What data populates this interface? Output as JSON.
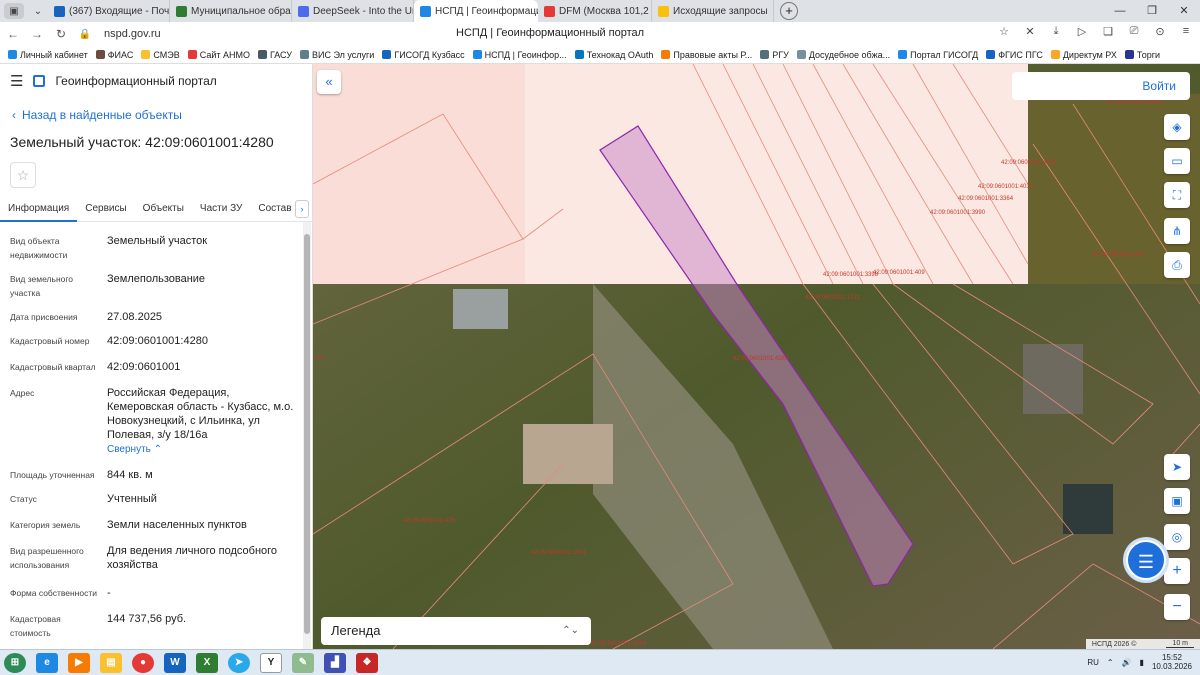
{
  "browser": {
    "tabs": [
      {
        "label": "(367) Входящие - Почта М",
        "fav_color": "#1565c0"
      },
      {
        "label": "Муниципальное образова",
        "fav_color": "#2e7d32"
      },
      {
        "label": "DeepSeek - Into the Unkno",
        "fav_color": "#4f6bed"
      },
      {
        "label": "НСПД | Геоинформацио",
        "fav_color": "#1e88e5",
        "active": true
      },
      {
        "label": "DFM (Москва 101,2",
        "fav_color": "#e53935"
      },
      {
        "label": "Исходящие запросы",
        "fav_color": "#f9c10b"
      }
    ],
    "new_tab": "+",
    "url": "nspd.gov.ru",
    "page_title": "НСПД | Геоинформационный портал",
    "bookmarks": [
      {
        "label": "Личный кабинет",
        "color": "#1e88e5"
      },
      {
        "label": "ФИАС",
        "color": "#6d4c41"
      },
      {
        "label": "СМЭВ",
        "color": "#fbc02d"
      },
      {
        "label": "Сайт АНМО",
        "color": "#e53935"
      },
      {
        "label": "ГАСУ",
        "color": "#455a64"
      },
      {
        "label": "ВИС Эл услуги",
        "color": "#607d8b"
      },
      {
        "label": "ГИСОГД Кузбасс",
        "color": "#1565c0"
      },
      {
        "label": "НСПД | Геоинфор...",
        "color": "#1e88e5"
      },
      {
        "label": "Технокад OAuth",
        "color": "#0277bd"
      },
      {
        "label": "Правовые акты Р...",
        "color": "#f57c00"
      },
      {
        "label": "РГУ",
        "color": "#546e7a"
      },
      {
        "label": "Досудебное обжа...",
        "color": "#78909c"
      },
      {
        "label": "Портал ГИСОГД",
        "color": "#1e88e5"
      },
      {
        "label": "ФГИС ПГС",
        "color": "#1565c0"
      },
      {
        "label": "Директум РХ",
        "color": "#f9a825"
      },
      {
        "label": "Торги",
        "color": "#283593"
      }
    ]
  },
  "panel": {
    "portal_name": "Геоинформационный портал",
    "back_label": "Назад в найденные объекты",
    "title": "Земельный участок: 42:09:0601001:4280",
    "tabs": [
      "Информация",
      "Сервисы",
      "Объекты",
      "Части ЗУ",
      "Состав"
    ],
    "rows": [
      {
        "label": "Вид объекта недвижимости",
        "value": "Земельный участок"
      },
      {
        "label": "Вид земельного участка",
        "value": "Землепользование"
      },
      {
        "label": "Дата присвоения",
        "value": "27.08.2025"
      },
      {
        "label": "Кадастровый номер",
        "value": "42:09:0601001:4280"
      },
      {
        "label": "Кадастровый квартал",
        "value": "42:09:0601001"
      },
      {
        "label": "Адрес",
        "value": "Российская Федерация, Кемеровская область - Кузбасс, м.о. Новокузнецкий, с Ильинка, ул Полевая, з/у 18/16а",
        "link": "Свернуть"
      },
      {
        "label": "Площадь уточненная",
        "value": "844 кв. м"
      },
      {
        "label": "Статус",
        "value": "Учтенный"
      },
      {
        "label": "Категория земель",
        "value": "Земли населенных пунктов"
      },
      {
        "label": "Вид разрешенного использования",
        "value": "Для ведения личного подсобного хозяйства"
      },
      {
        "label": "Форма собственности",
        "value": "-"
      },
      {
        "label": "Кадастровая стоимость",
        "value": "144 737,56 руб."
      }
    ]
  },
  "map": {
    "login_label": "Войти",
    "legend_label": "Легенда",
    "attribution": "НСПД 2026 ©",
    "scale_label": "10 m",
    "parcel_labels": [
      "42:09:0601001:4028",
      "42:09:0601001:4078",
      "42:09:0601001:4037",
      "42:09:0601001:3364",
      "42:09:0601001:3990",
      "42:09:0601001:3398",
      "42:09:0601001:409",
      "42:09:0601001:1721",
      "42:09:0601001:4280",
      "42:09:0601001:413",
      "42:09:0601001:478",
      "42:09:0601001:1001",
      "42:09:0601001:1004",
      "411"
    ]
  },
  "taskbar": {
    "lang": "RU",
    "time": "15:52",
    "date": "10.03.2026"
  }
}
